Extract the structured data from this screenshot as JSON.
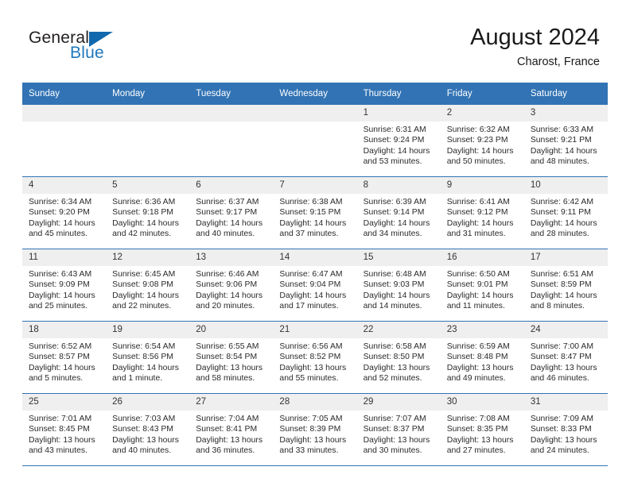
{
  "brand": {
    "name_part1": "General",
    "name_part2": "Blue",
    "flag_icon": "blue-triangle-flag"
  },
  "header": {
    "title": "August 2024",
    "subtitle": "Charost, France"
  },
  "calendar": {
    "weekday_headers": [
      "Sunday",
      "Monday",
      "Tuesday",
      "Wednesday",
      "Thursday",
      "Friday",
      "Saturday"
    ],
    "colors": {
      "header_blue": "#3173b4",
      "daynum_gray": "#efeff0",
      "brand_blue": "#1f77bc",
      "text": "#2a2a2a"
    },
    "labels": {
      "sunrise_prefix": "Sunrise:",
      "sunset_prefix": "Sunset:",
      "daylight_prefix": "Daylight:"
    },
    "weeks": [
      [
        {
          "day": "",
          "blank": true
        },
        {
          "day": "",
          "blank": true
        },
        {
          "day": "",
          "blank": true
        },
        {
          "day": "",
          "blank": true
        },
        {
          "day": "1",
          "sunrise": "Sunrise: 6:31 AM",
          "sunset": "Sunset: 9:24 PM",
          "daylight_line1": "Daylight: 14 hours",
          "daylight_line2": "and 53 minutes."
        },
        {
          "day": "2",
          "sunrise": "Sunrise: 6:32 AM",
          "sunset": "Sunset: 9:23 PM",
          "daylight_line1": "Daylight: 14 hours",
          "daylight_line2": "and 50 minutes."
        },
        {
          "day": "3",
          "sunrise": "Sunrise: 6:33 AM",
          "sunset": "Sunset: 9:21 PM",
          "daylight_line1": "Daylight: 14 hours",
          "daylight_line2": "and 48 minutes."
        }
      ],
      [
        {
          "day": "4",
          "sunrise": "Sunrise: 6:34 AM",
          "sunset": "Sunset: 9:20 PM",
          "daylight_line1": "Daylight: 14 hours",
          "daylight_line2": "and 45 minutes."
        },
        {
          "day": "5",
          "sunrise": "Sunrise: 6:36 AM",
          "sunset": "Sunset: 9:18 PM",
          "daylight_line1": "Daylight: 14 hours",
          "daylight_line2": "and 42 minutes."
        },
        {
          "day": "6",
          "sunrise": "Sunrise: 6:37 AM",
          "sunset": "Sunset: 9:17 PM",
          "daylight_line1": "Daylight: 14 hours",
          "daylight_line2": "and 40 minutes."
        },
        {
          "day": "7",
          "sunrise": "Sunrise: 6:38 AM",
          "sunset": "Sunset: 9:15 PM",
          "daylight_line1": "Daylight: 14 hours",
          "daylight_line2": "and 37 minutes."
        },
        {
          "day": "8",
          "sunrise": "Sunrise: 6:39 AM",
          "sunset": "Sunset: 9:14 PM",
          "daylight_line1": "Daylight: 14 hours",
          "daylight_line2": "and 34 minutes."
        },
        {
          "day": "9",
          "sunrise": "Sunrise: 6:41 AM",
          "sunset": "Sunset: 9:12 PM",
          "daylight_line1": "Daylight: 14 hours",
          "daylight_line2": "and 31 minutes."
        },
        {
          "day": "10",
          "sunrise": "Sunrise: 6:42 AM",
          "sunset": "Sunset: 9:11 PM",
          "daylight_line1": "Daylight: 14 hours",
          "daylight_line2": "and 28 minutes."
        }
      ],
      [
        {
          "day": "11",
          "sunrise": "Sunrise: 6:43 AM",
          "sunset": "Sunset: 9:09 PM",
          "daylight_line1": "Daylight: 14 hours",
          "daylight_line2": "and 25 minutes."
        },
        {
          "day": "12",
          "sunrise": "Sunrise: 6:45 AM",
          "sunset": "Sunset: 9:08 PM",
          "daylight_line1": "Daylight: 14 hours",
          "daylight_line2": "and 22 minutes."
        },
        {
          "day": "13",
          "sunrise": "Sunrise: 6:46 AM",
          "sunset": "Sunset: 9:06 PM",
          "daylight_line1": "Daylight: 14 hours",
          "daylight_line2": "and 20 minutes."
        },
        {
          "day": "14",
          "sunrise": "Sunrise: 6:47 AM",
          "sunset": "Sunset: 9:04 PM",
          "daylight_line1": "Daylight: 14 hours",
          "daylight_line2": "and 17 minutes."
        },
        {
          "day": "15",
          "sunrise": "Sunrise: 6:48 AM",
          "sunset": "Sunset: 9:03 PM",
          "daylight_line1": "Daylight: 14 hours",
          "daylight_line2": "and 14 minutes."
        },
        {
          "day": "16",
          "sunrise": "Sunrise: 6:50 AM",
          "sunset": "Sunset: 9:01 PM",
          "daylight_line1": "Daylight: 14 hours",
          "daylight_line2": "and 11 minutes."
        },
        {
          "day": "17",
          "sunrise": "Sunrise: 6:51 AM",
          "sunset": "Sunset: 8:59 PM",
          "daylight_line1": "Daylight: 14 hours",
          "daylight_line2": "and 8 minutes."
        }
      ],
      [
        {
          "day": "18",
          "sunrise": "Sunrise: 6:52 AM",
          "sunset": "Sunset: 8:57 PM",
          "daylight_line1": "Daylight: 14 hours",
          "daylight_line2": "and 5 minutes."
        },
        {
          "day": "19",
          "sunrise": "Sunrise: 6:54 AM",
          "sunset": "Sunset: 8:56 PM",
          "daylight_line1": "Daylight: 14 hours",
          "daylight_line2": "and 1 minute."
        },
        {
          "day": "20",
          "sunrise": "Sunrise: 6:55 AM",
          "sunset": "Sunset: 8:54 PM",
          "daylight_line1": "Daylight: 13 hours",
          "daylight_line2": "and 58 minutes."
        },
        {
          "day": "21",
          "sunrise": "Sunrise: 6:56 AM",
          "sunset": "Sunset: 8:52 PM",
          "daylight_line1": "Daylight: 13 hours",
          "daylight_line2": "and 55 minutes."
        },
        {
          "day": "22",
          "sunrise": "Sunrise: 6:58 AM",
          "sunset": "Sunset: 8:50 PM",
          "daylight_line1": "Daylight: 13 hours",
          "daylight_line2": "and 52 minutes."
        },
        {
          "day": "23",
          "sunrise": "Sunrise: 6:59 AM",
          "sunset": "Sunset: 8:48 PM",
          "daylight_line1": "Daylight: 13 hours",
          "daylight_line2": "and 49 minutes."
        },
        {
          "day": "24",
          "sunrise": "Sunrise: 7:00 AM",
          "sunset": "Sunset: 8:47 PM",
          "daylight_line1": "Daylight: 13 hours",
          "daylight_line2": "and 46 minutes."
        }
      ],
      [
        {
          "day": "25",
          "sunrise": "Sunrise: 7:01 AM",
          "sunset": "Sunset: 8:45 PM",
          "daylight_line1": "Daylight: 13 hours",
          "daylight_line2": "and 43 minutes."
        },
        {
          "day": "26",
          "sunrise": "Sunrise: 7:03 AM",
          "sunset": "Sunset: 8:43 PM",
          "daylight_line1": "Daylight: 13 hours",
          "daylight_line2": "and 40 minutes."
        },
        {
          "day": "27",
          "sunrise": "Sunrise: 7:04 AM",
          "sunset": "Sunset: 8:41 PM",
          "daylight_line1": "Daylight: 13 hours",
          "daylight_line2": "and 36 minutes."
        },
        {
          "day": "28",
          "sunrise": "Sunrise: 7:05 AM",
          "sunset": "Sunset: 8:39 PM",
          "daylight_line1": "Daylight: 13 hours",
          "daylight_line2": "and 33 minutes."
        },
        {
          "day": "29",
          "sunrise": "Sunrise: 7:07 AM",
          "sunset": "Sunset: 8:37 PM",
          "daylight_line1": "Daylight: 13 hours",
          "daylight_line2": "and 30 minutes."
        },
        {
          "day": "30",
          "sunrise": "Sunrise: 7:08 AM",
          "sunset": "Sunset: 8:35 PM",
          "daylight_line1": "Daylight: 13 hours",
          "daylight_line2": "and 27 minutes."
        },
        {
          "day": "31",
          "sunrise": "Sunrise: 7:09 AM",
          "sunset": "Sunset: 8:33 PM",
          "daylight_line1": "Daylight: 13 hours",
          "daylight_line2": "and 24 minutes."
        }
      ]
    ]
  }
}
